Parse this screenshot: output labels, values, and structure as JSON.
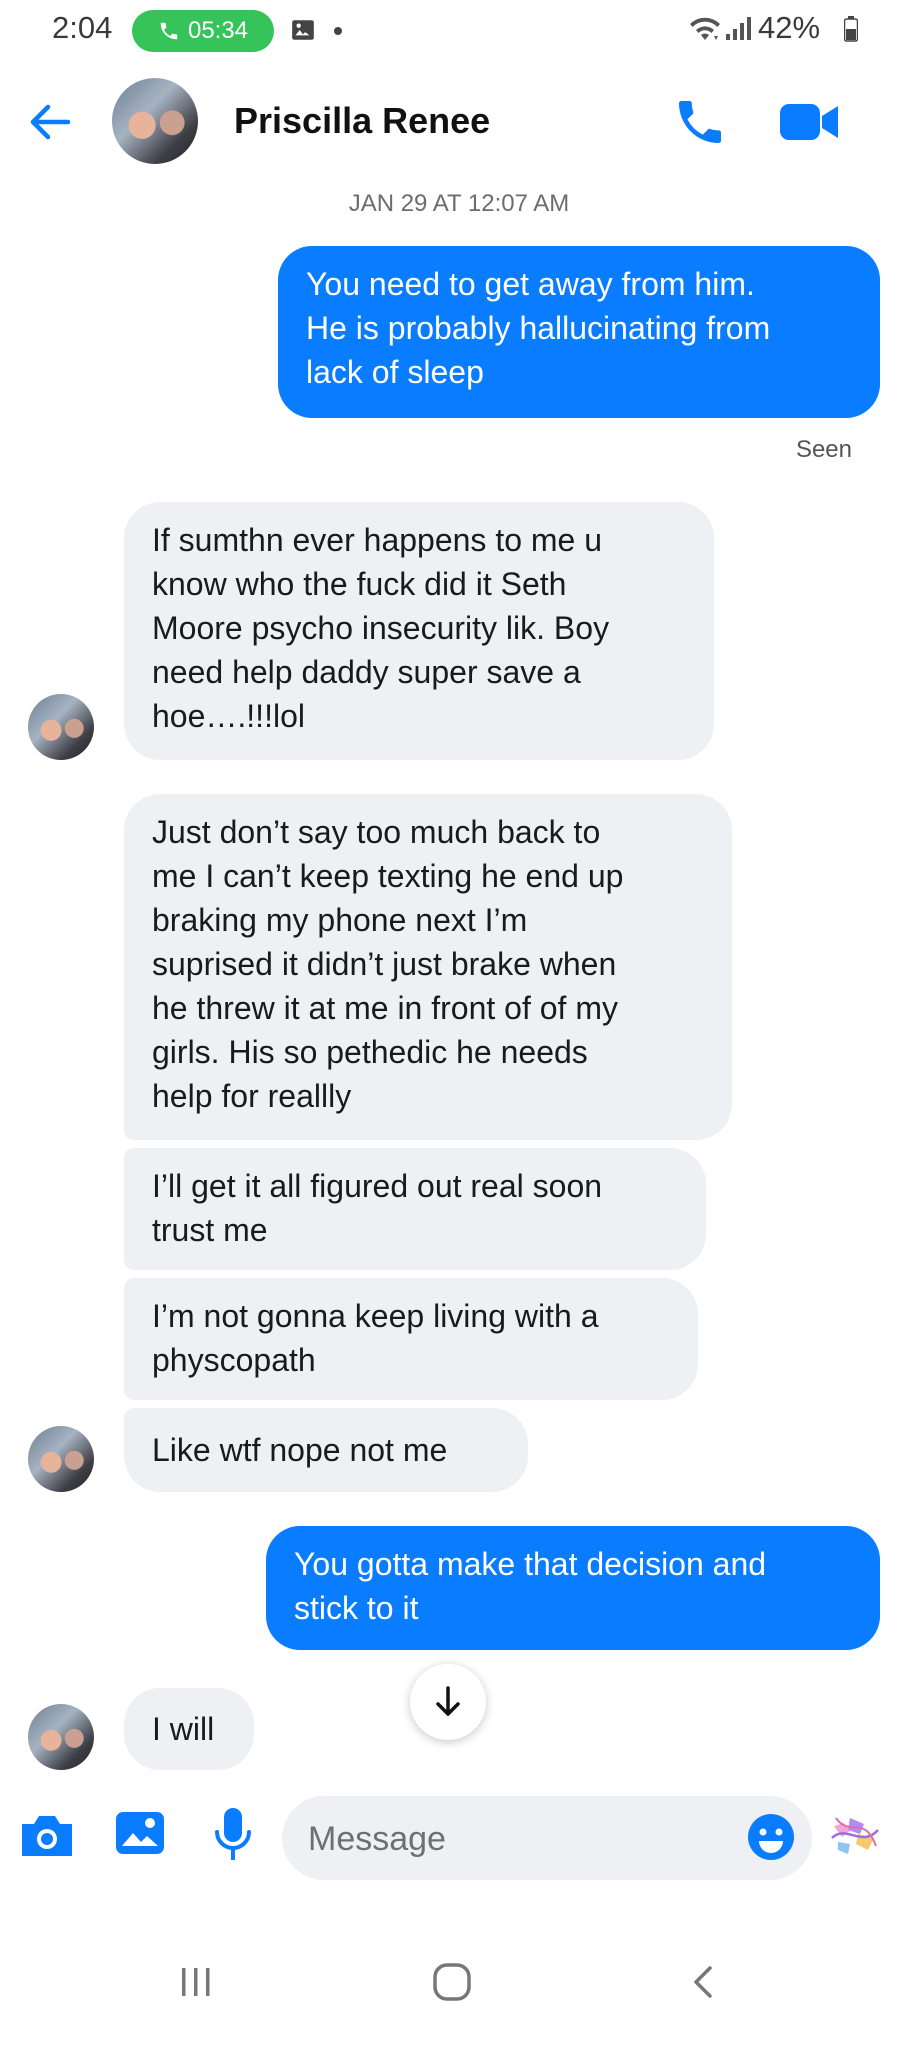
{
  "status_bar": {
    "time": "2:04",
    "call_timer": "05:34",
    "battery_percent": "42%"
  },
  "header": {
    "contact_name": "Priscilla Renee"
  },
  "conversation": {
    "timestamp": "JAN 29 AT 12:07 AM",
    "seen_label": "Seen",
    "messages": [
      {
        "from": "me",
        "text": "You need to get away from him.\nHe is probably hallucinating from\nlack of sleep"
      },
      {
        "from": "them",
        "text": "If sumthn ever happens to me u\nknow who the fuck did it Seth\nMoore psycho insecurity lik. Boy\nneed help daddy super save a\nhoe….!!!lol"
      },
      {
        "from": "them",
        "text": "Just don’t say too much back to\nme I can’t keep texting he end up\nbraking my phone next I’m\nsuprised it didn’t just brake when\nhe threw it at me in front of of my\ngirls. His so pethedic he needs\nhelp for reallly"
      },
      {
        "from": "them",
        "text": "I’ll get it all figured out real soon\ntrust me"
      },
      {
        "from": "them",
        "text": "I’m not gonna keep living with a\nphyscopath"
      },
      {
        "from": "them",
        "text": "Like wtf nope not me"
      },
      {
        "from": "me",
        "text": "You gotta make that decision and\nstick to it"
      },
      {
        "from": "them",
        "text": "I will"
      }
    ]
  },
  "composer": {
    "placeholder": "Message"
  },
  "icons": {
    "accent": "#0a7cff",
    "call_green": "#35c35a"
  }
}
